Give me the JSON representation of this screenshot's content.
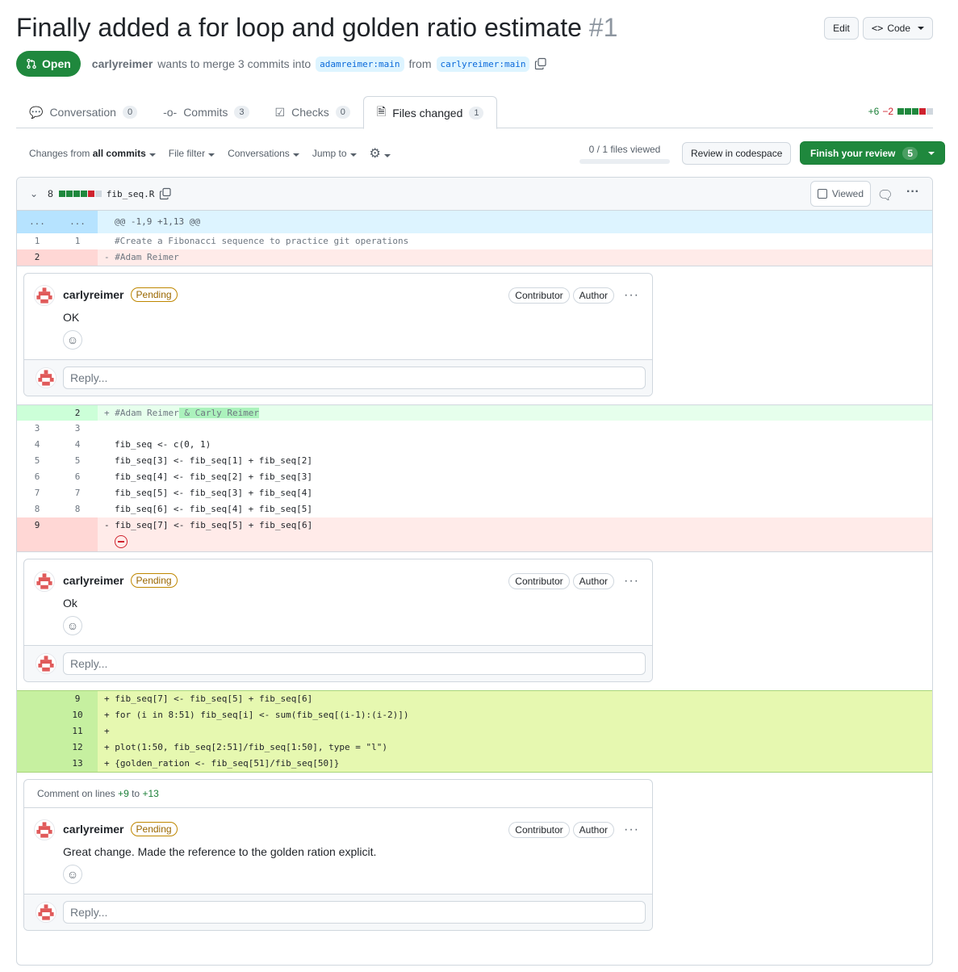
{
  "pr": {
    "title": "Finally added a for loop and golden ratio estimate",
    "number": "#1",
    "status": "Open",
    "user": "carlyreimer",
    "merge_text": "wants to merge 3 commits into",
    "base_branch": "adamreimer:main",
    "from_text": "from",
    "head_branch": "carlyreimer:main",
    "edit_label": "Edit",
    "code_label": "Code"
  },
  "tabs": [
    {
      "label": "Conversation",
      "count": "0"
    },
    {
      "label": "Commits",
      "count": "3"
    },
    {
      "label": "Checks",
      "count": "0"
    },
    {
      "label": "Files changed",
      "count": "1"
    }
  ],
  "diffstat": {
    "add": "+6",
    "del": "−2"
  },
  "toolbar": {
    "changes_from": "Changes from",
    "all_commits": "all commits",
    "file_filter": "File filter",
    "conversations": "Conversations",
    "jump_to": "Jump to",
    "files_viewed": "0 / 1 files viewed",
    "files_viewed_fraction": 0,
    "review_codespace": "Review in codespace",
    "finish_review": "Finish your review",
    "finish_count": "5"
  },
  "file": {
    "changes": "8",
    "name": "fib_seq.R",
    "viewed_label": "Viewed"
  },
  "diff": {
    "hunk": {
      "ln_old": "...",
      "ln_new": "...",
      "text": "@@ -1,9 +1,13 @@"
    },
    "l1": {
      "old": "1",
      "new": "1",
      "text": "#Create a Fibonacci sequence to practice git operations"
    },
    "l2del": {
      "old": "2",
      "text": "- #Adam Reimer"
    },
    "l2add": {
      "new": "2",
      "prefix": "+ #Adam Reimer",
      "hl": " & Carly Reimer"
    },
    "ctx": [
      {
        "old": "3",
        "new": "3",
        "text": ""
      },
      {
        "old": "4",
        "new": "4",
        "text": "fib_seq <- c(0, 1)"
      },
      {
        "old": "5",
        "new": "5",
        "text": "fib_seq[3] <- fib_seq[1] + fib_seq[2]"
      },
      {
        "old": "6",
        "new": "6",
        "text": "fib_seq[4] <- fib_seq[2] + fib_seq[3]"
      },
      {
        "old": "7",
        "new": "7",
        "text": "fib_seq[5] <- fib_seq[3] + fib_seq[4]"
      },
      {
        "old": "8",
        "new": "8",
        "text": "fib_seq[6] <- fib_seq[4] + fib_seq[5]"
      }
    ],
    "l9del": {
      "old": "9",
      "text": "- fib_seq[7] <- fib_seq[5] + fib_seq[6]"
    },
    "added": [
      {
        "new": "9",
        "text": "+ fib_seq[7] <- fib_seq[5] + fib_seq[6]"
      },
      {
        "new": "10",
        "text": "+ for (i in 8:51) fib_seq[i] <- sum(fib_seq[(i-1):(i-2)])"
      },
      {
        "new": "11",
        "text": "+"
      },
      {
        "new": "12",
        "text": "+ plot(1:50, fib_seq[2:51]/fib_seq[1:50], type = \"l\")"
      },
      {
        "new": "13",
        "text": "+ {golden_ration <- fib_seq[51]/fib_seq[50]}"
      }
    ]
  },
  "comments": [
    {
      "author": "carlyreimer",
      "status": "Pending",
      "role1": "Contributor",
      "role2": "Author",
      "body": "OK",
      "reply": "Reply..."
    },
    {
      "author": "carlyreimer",
      "status": "Pending",
      "role1": "Contributor",
      "role2": "Author",
      "body": "Ok",
      "reply": "Reply..."
    },
    {
      "author": "carlyreimer",
      "status": "Pending",
      "role1": "Contributor",
      "role2": "Author",
      "body": "Great change. Made the reference to the golden ration explicit.",
      "reply": "Reply...",
      "range_prefix": "Comment on lines",
      "range_start": "+9",
      "range_to": "to",
      "range_end": "+13"
    }
  ]
}
